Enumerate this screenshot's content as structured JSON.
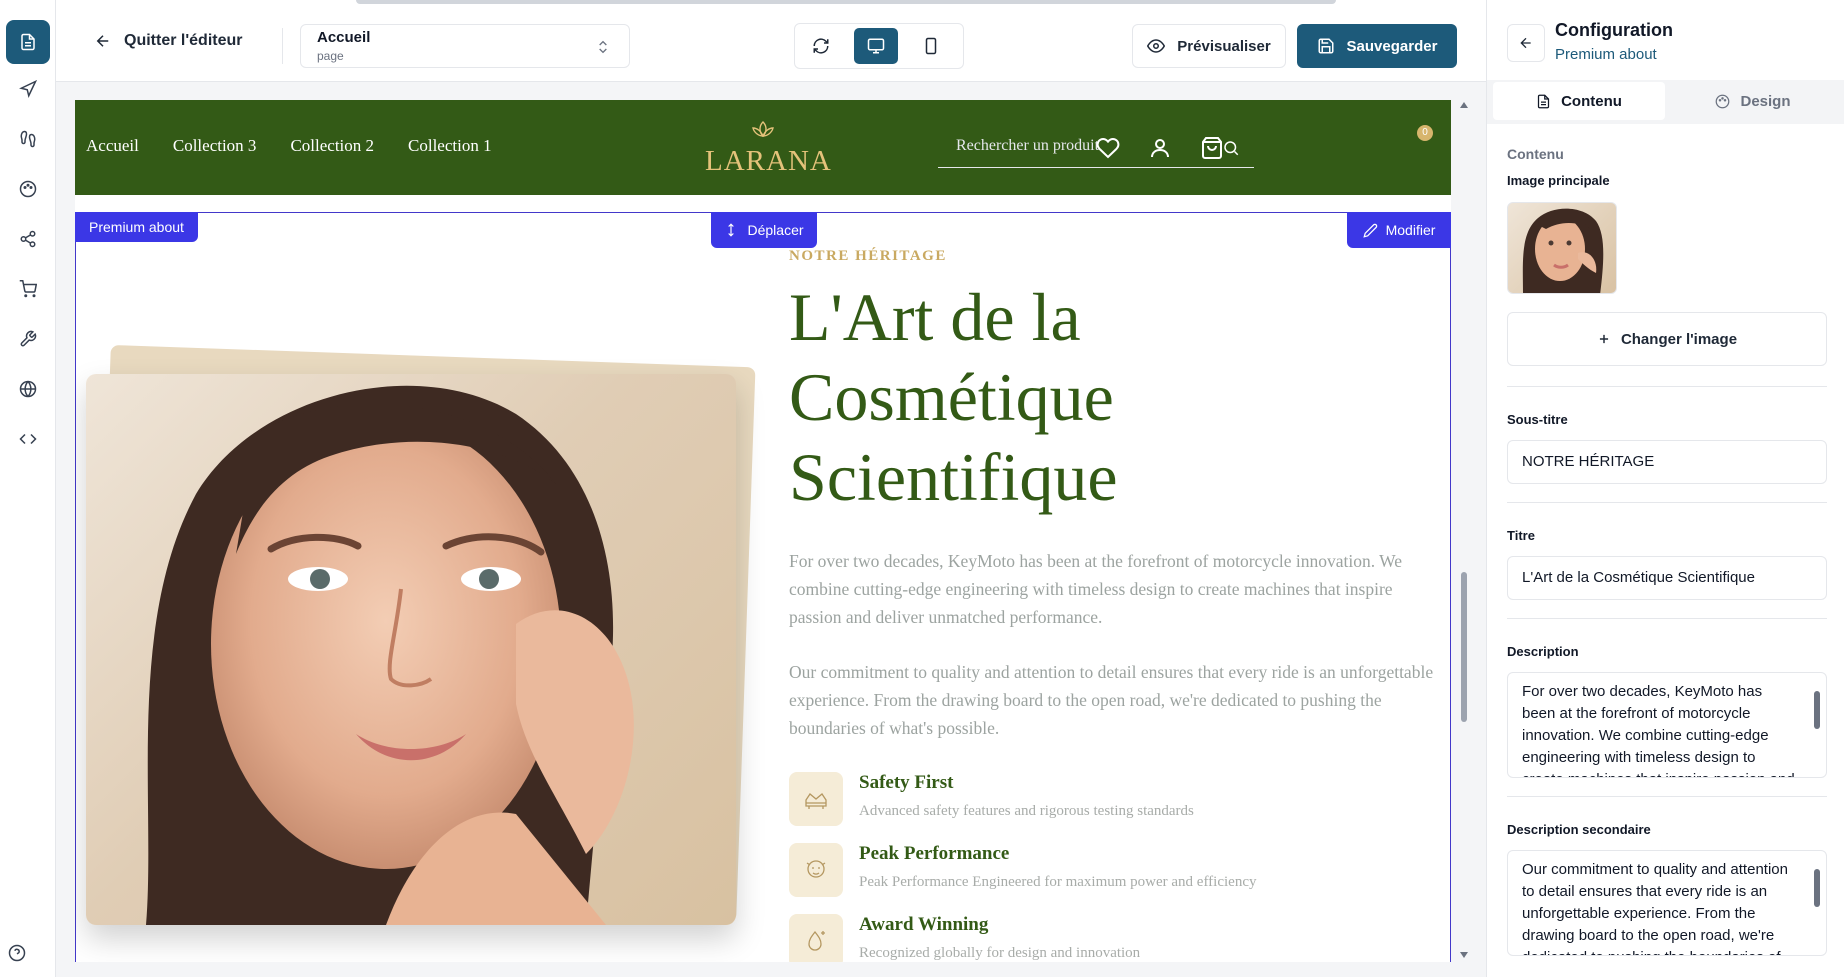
{
  "rail": {
    "items": [
      "pages-icon",
      "send-icon",
      "footprints-icon",
      "palette-icon",
      "share-icon",
      "cart-icon",
      "wrench-icon",
      "globe-icon",
      "code-icon"
    ],
    "help_icon": "help-circle-icon",
    "active_color": "#1d5a7a"
  },
  "topbar": {
    "quit_label": "Quitter l'éditeur",
    "page_select": {
      "title": "Accueil",
      "subtitle": "page"
    },
    "devices": [
      "refresh-icon",
      "desktop-icon",
      "mobile-icon"
    ],
    "active_device": "desktop",
    "preview_label": "Prévisualiser",
    "save_label": "Sauvegarder"
  },
  "site": {
    "nav": {
      "links": [
        "Accueil",
        "Collection 3",
        "Collection 2",
        "Collection 1"
      ],
      "logo": "LARANA",
      "search_placeholder": "Rechercher un produit",
      "cart_count": "0",
      "bg_color": "#335a16",
      "accent_color": "#e4c27a"
    },
    "section": {
      "name_tag": "Premium about",
      "move_label": "Déplacer",
      "edit_label": "Modifier",
      "subtitle": "NOTRE HÉRITAGE",
      "title": "L'Art de la Cosmétique Scientifique",
      "description": "For over two decades, KeyMoto has been at the forefront of motorcycle innovation. We combine cutting-edge engineering with timeless design to create machines that inspire passion and deliver unmatched performance.",
      "description2": "Our commitment to quality and attention to detail ensures that every ride is an unforgettable experience. From the drawing board to the open road, we're dedicated to pushing the boundaries of what's possible.",
      "features": [
        {
          "icon": "crown-icon",
          "title": "Safety First",
          "desc": "Advanced safety features and rigorous testing standards"
        },
        {
          "icon": "face-icon",
          "title": "Peak Performance",
          "desc": "Peak Performance Engineered for maximum power and efficiency"
        },
        {
          "icon": "drop-icon",
          "title": "Award Winning",
          "desc": "Recognized globally for design and innovation"
        }
      ]
    }
  },
  "panel": {
    "title": "Configuration",
    "subtitle": "Premium about",
    "tabs": [
      {
        "label": "Contenu",
        "icon": "document-icon",
        "active": true
      },
      {
        "label": "Design",
        "icon": "palette-icon",
        "active": false
      }
    ],
    "section_label": "Contenu",
    "main_image_label": "Image principale",
    "change_image_label": "Changer l'image",
    "subtitle_label": "Sous-titre",
    "subtitle_value": "NOTRE HÉRITAGE",
    "title_label": "Titre",
    "title_value": "L'Art de la Cosmétique Scientifique",
    "description_label": "Description",
    "description_value": "For over two decades, KeyMoto has been at the forefront of motorcycle innovation. We combine cutting-edge engineering with timeless design to create machines that inspire passion and deliver unmatched performance.",
    "description2_label": "Description secondaire",
    "description2_value": "Our commitment to quality and attention to detail ensures that every ride is an unforgettable experience. From the drawing board to the open road, we're dedicated to pushing the boundaries of what's possible."
  }
}
